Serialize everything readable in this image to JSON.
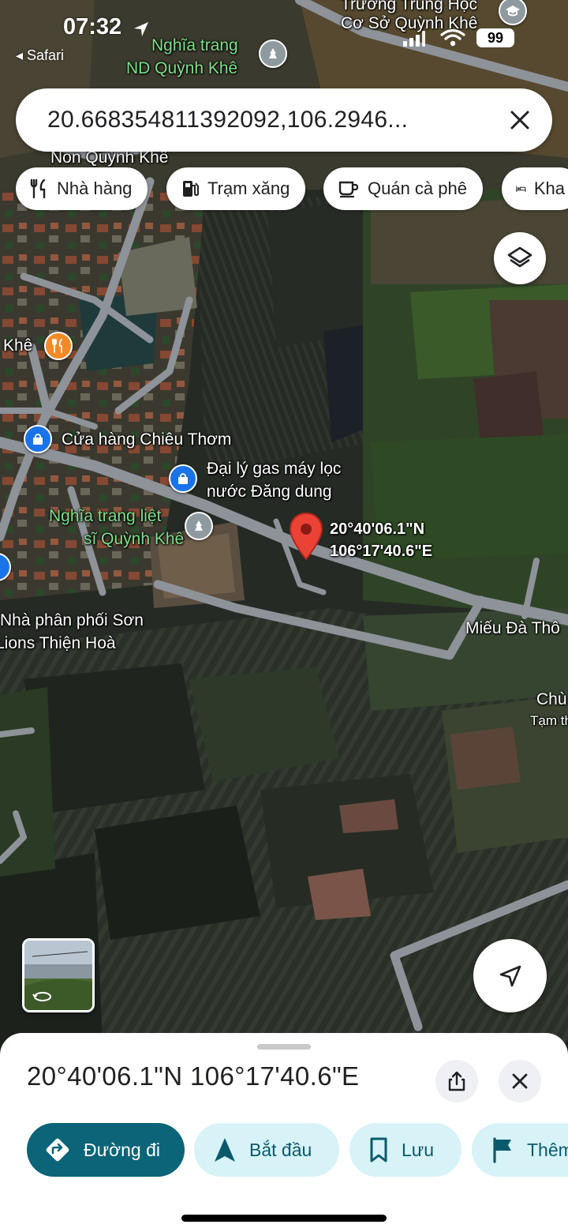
{
  "status_bar": {
    "time": "07:32",
    "back_label": "◂ Safari",
    "battery": "99",
    "location_icon": "location-arrow-icon",
    "signal_icon": "cellular-signal-icon",
    "wifi_icon": "wifi-icon"
  },
  "search": {
    "query": "20.668354811392092,106.2946...",
    "clear_icon": "close-icon"
  },
  "chips": [
    {
      "label": "Nhà hàng",
      "icon": "fork-knife-icon"
    },
    {
      "label": "Trạm xăng",
      "icon": "gas-pump-icon"
    },
    {
      "label": "Quán cà phê",
      "icon": "coffee-cup-icon"
    },
    {
      "label": "Kha",
      "icon": "bed-icon"
    }
  ],
  "map": {
    "labels": {
      "school_line1": "Trường Trung Học",
      "school_line2": "Cơ Sở Quỳnh Khê",
      "cemetery_line1": "Nghĩa trang",
      "cemetery_line2": "ND Quỳnh Khê",
      "non_quynh_khe": "Non Quỳnh Khê",
      "khe": "Khê",
      "shop_chieu_thom": "Cửa hàng Chiêu Thơm",
      "gas_line1": "Đại lý gas máy lọc",
      "gas_line2": "nước Đăng dung",
      "martyr_line1": "Nghĩa trang liệt",
      "martyr_line2": "sĩ Quỳnh Khê",
      "pin_line1": "20°40'06.1\"N",
      "pin_line2": "106°17'40.6\"E",
      "paint_line1": "Nhà phân phối Sơn",
      "paint_line2": "Lions Thiện Hoà",
      "mieu": "Miếu Đà Thô",
      "chua": "Chù",
      "tam": "Tạm th"
    },
    "colors": {
      "pin": "#ea4335",
      "restaurant_poi": "#f28b27",
      "shop_poi": "#1a73e8",
      "landmark_poi": "#8e9aa0",
      "green_label": "#7ee08a"
    }
  },
  "controls": {
    "layers_icon": "layers-icon",
    "locate_icon": "navigation-arrow-icon",
    "street_view_icon": "rotate-360-icon"
  },
  "sheet": {
    "title": "20°40'06.1\"N 106°17'40.6\"E",
    "share_icon": "share-icon",
    "close_icon": "close-icon",
    "actions": [
      {
        "label": "Đường đi",
        "icon": "directions-icon"
      },
      {
        "label": "Bắt đầu",
        "icon": "navigation-icon"
      },
      {
        "label": "Lưu",
        "icon": "bookmark-icon"
      },
      {
        "label": "Thêm",
        "icon": "flag-icon"
      }
    ],
    "colors": {
      "primary": "#0b6477",
      "secondary": "#d7f3f7",
      "secondary_text": "#0b5a6b"
    }
  }
}
